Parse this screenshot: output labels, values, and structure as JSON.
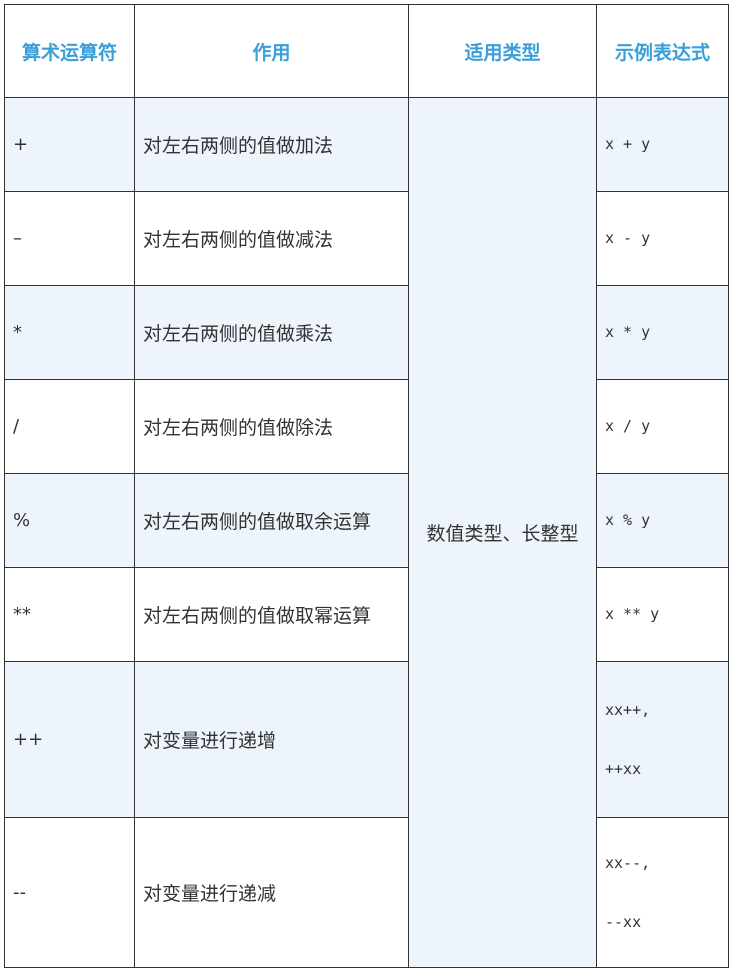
{
  "headers": [
    "算术运算符",
    "作用",
    "适用类型",
    "示例表达式"
  ],
  "type_value": "数值类型、长整型",
  "rows": [
    {
      "operator": "+",
      "effect": "对左右两侧的值做加法",
      "example": [
        "x + y"
      ]
    },
    {
      "operator": "–",
      "effect": "对左右两侧的值做减法",
      "example": [
        "x - y"
      ]
    },
    {
      "operator": "*",
      "effect": "对左右两侧的值做乘法",
      "example": [
        "x * y"
      ]
    },
    {
      "operator": "/",
      "effect": "对左右两侧的值做除法",
      "example": [
        "x / y"
      ]
    },
    {
      "operator": "%",
      "effect": "对左右两侧的值做取余运算",
      "example": [
        "x % y"
      ]
    },
    {
      "operator": "**",
      "effect": "对左右两侧的值做取幂运算",
      "example": [
        "x ** y"
      ]
    },
    {
      "operator": "++",
      "effect": "对变量进行递增",
      "example": [
        "xx++,",
        "++xx"
      ]
    },
    {
      "operator": "--",
      "effect": "对变量进行递减",
      "example": [
        "xx--,",
        "--xx"
      ]
    }
  ]
}
